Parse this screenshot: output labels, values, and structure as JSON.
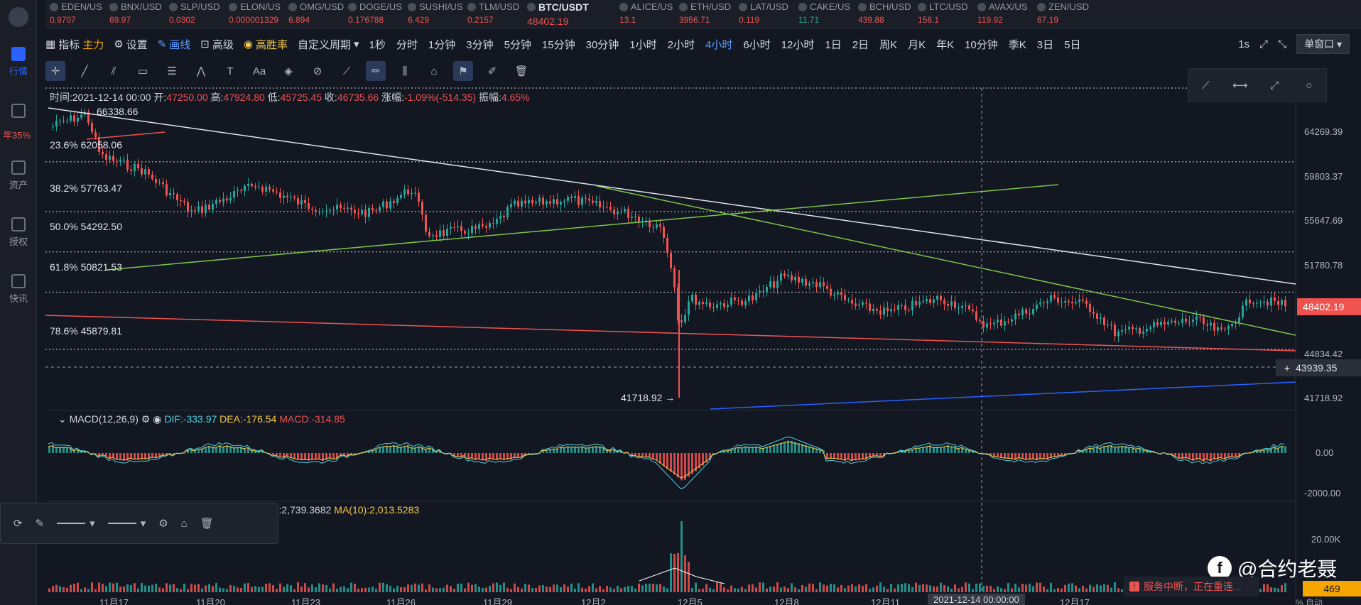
{
  "ticker": [
    {
      "symbol": "EDEN/US",
      "price": "0.9707"
    },
    {
      "symbol": "BNX/USD",
      "price": "69.97"
    },
    {
      "symbol": "SLP/USD",
      "price": "0.0302"
    },
    {
      "symbol": "ELON/US",
      "price": "0.000001329"
    },
    {
      "symbol": "OMG/USD",
      "price": "6.894"
    },
    {
      "symbol": "DOGE/US",
      "price": "0.176788"
    },
    {
      "symbol": "SUSHI/US",
      "price": "6.429"
    },
    {
      "symbol": "TLM/USD",
      "price": "0.2157"
    },
    {
      "symbol": "BTC/USDT",
      "price": "48402.19",
      "main": true
    },
    {
      "symbol": "ALICE/US",
      "price": "13.1"
    },
    {
      "symbol": "ETH/USD",
      "price": "3956.71"
    },
    {
      "symbol": "LAT/USD",
      "price": "0.119"
    },
    {
      "symbol": "CAKE/US",
      "price": "11.71",
      "up": true
    },
    {
      "symbol": "BCH/USD",
      "price": "439.88"
    },
    {
      "symbol": "LTC/USD",
      "price": "156.1"
    },
    {
      "symbol": "AVAX/US",
      "price": "119.92"
    },
    {
      "symbol": "ZEN/USD",
      "price": "67.19"
    }
  ],
  "sidebar": {
    "items": [
      {
        "label": "行情",
        "icon": "market-icon",
        "active": true
      },
      {
        "label": "",
        "icon": "percent-icon"
      },
      {
        "label": "资产",
        "icon": "wallet-icon"
      },
      {
        "label": "授权",
        "icon": "key-icon"
      },
      {
        "label": "快讯",
        "icon": "news-icon"
      }
    ],
    "badge": "年35%"
  },
  "toolbar": {
    "indicator": "指标",
    "main": "主力",
    "settings": "设置",
    "draw": "画线",
    "advanced": "高级",
    "winrate": "高胜率",
    "custom_period": "自定义周期",
    "timeframes": [
      "1秒",
      "分时",
      "1分钟",
      "3分钟",
      "5分钟",
      "15分钟",
      "30分钟",
      "1小时",
      "2小时",
      "4小时",
      "6小时",
      "12小时",
      "1日",
      "2日",
      "周K",
      "月K",
      "年K",
      "10分钟",
      "季K",
      "3日",
      "5日"
    ],
    "active_timeframe": "4小时",
    "right_interval": "1s",
    "window_mode": "单窗口"
  },
  "ohlc": {
    "time_label": "时间:",
    "time": "2021-12-14 00:00",
    "open_label": "开:",
    "open": "47250.00",
    "high_label": "高:",
    "high": "47924.80",
    "low_label": "低:",
    "low": "45725.45",
    "close_label": "收:",
    "close": "46735.66",
    "change_label": "涨幅:",
    "change": "-1.09%(-514.35)",
    "amp_label": "振幅:",
    "amp": "4.65%"
  },
  "fib_levels": [
    {
      "label": "23.6% 62058.06",
      "price": 62058.06
    },
    {
      "label": "38.2% 57763.47",
      "price": 57763.47
    },
    {
      "label": "50.0% 54292.50",
      "price": 54292.5
    },
    {
      "label": "61.8% 50821.53",
      "price": 50821.53
    },
    {
      "label": "78.6% 45879.81",
      "price": 45879.81
    }
  ],
  "annotations": {
    "high": "66338.66",
    "low": "41718.92 →"
  },
  "price_axis": {
    "ticks": [
      "64269.39",
      "59803.37",
      "55647.69",
      "51780.78",
      "44834.42",
      "41718.92"
    ],
    "current": "48402.19",
    "crosshair": "43939.35",
    "macd_ticks": [
      "0.00",
      "-2000.00"
    ],
    "vol_ticks": [
      "20.00K"
    ]
  },
  "date_axis": {
    "ticks": [
      "11月17",
      "11月20",
      "11月23",
      "11月26",
      "11月29",
      "12月2",
      "12月5",
      "12月8",
      "12月11",
      "12月17"
    ],
    "crosshair": "2021-12-14 00:00:00"
  },
  "macd": {
    "label": "MACD(12,26,9)",
    "dif": "DIF:-333.97",
    "dea": "DEA:-176.54",
    "macd": "MACD:-314.85"
  },
  "volume": {
    "label": "5):2,739.3682",
    "ma": "MA(10):2,013.5283",
    "tag": "469"
  },
  "toast": "服务中断，正在重连...",
  "watermark": "@合约老聂",
  "watermark_logo": "f",
  "bottom_right": "% 自动"
}
